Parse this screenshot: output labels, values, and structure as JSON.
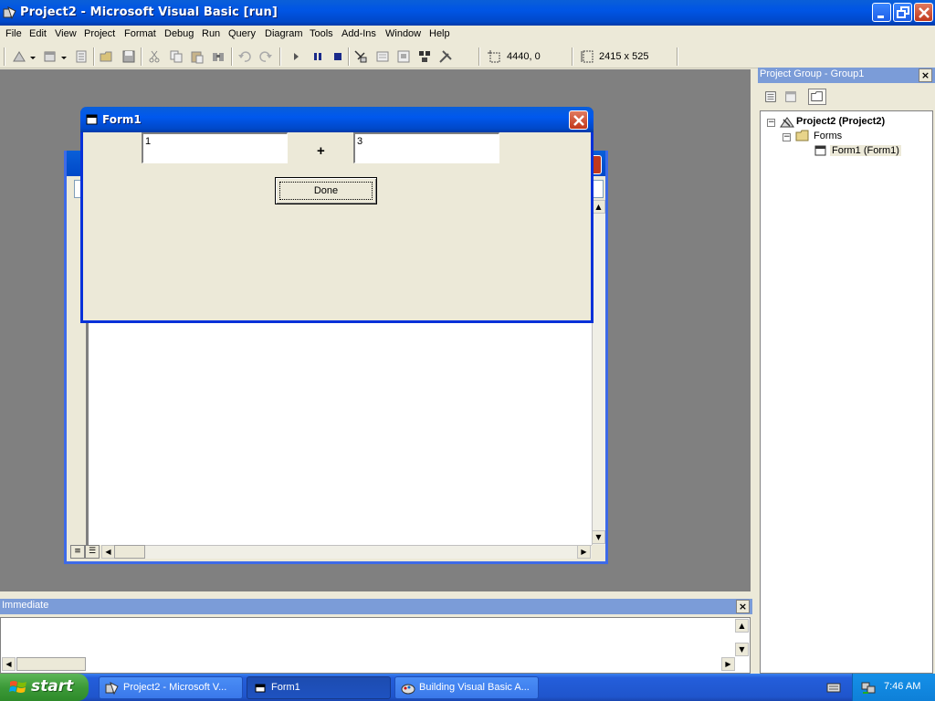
{
  "window": {
    "title": "Project2 - Microsoft Visual Basic [run]"
  },
  "menu": [
    "File",
    "Edit",
    "View",
    "Project",
    "Format",
    "Debug",
    "Run",
    "Query",
    "Diagram",
    "Tools",
    "Add-Ins",
    "Window",
    "Help"
  ],
  "toolbar": {
    "position_readout": "4440, 0",
    "size_readout": "2415 x 525"
  },
  "form1": {
    "title": "Form1",
    "textbox_left_value": "1",
    "operator": "+",
    "textbox_right_value": "3",
    "done_label": "Done"
  },
  "project_group": {
    "title": "Project Group - Group1",
    "close_glyph": "×",
    "project_node": "Project2 (Project2)",
    "forms_node": "Forms",
    "form_node": "Form1 (Form1)"
  },
  "immediate": {
    "title": "Immediate",
    "close_glyph": "×",
    "content": ""
  },
  "taskbar": {
    "start_label": "start",
    "buttons": [
      {
        "label": "Project2 - Microsoft V..."
      },
      {
        "label": "Form1"
      },
      {
        "label": "Building Visual Basic A..."
      }
    ],
    "clock": "7:46 AM"
  },
  "colors": {
    "xp_blue": "#0058ee",
    "mdi_background": "#808080",
    "panel_title": "#7b9cd8",
    "close_red": "#c2381c",
    "start_green": "#3c9a38"
  }
}
